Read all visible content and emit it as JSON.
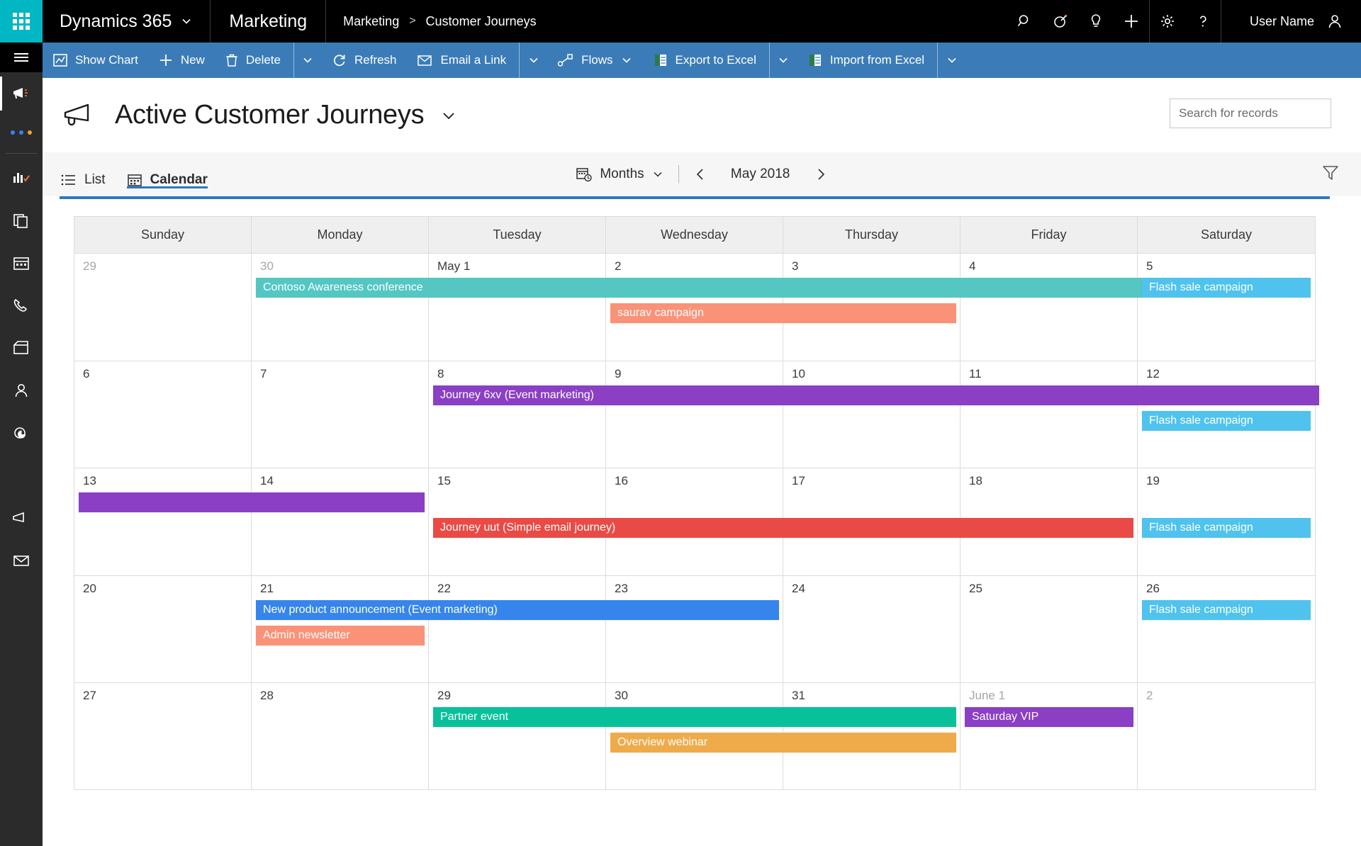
{
  "topbar": {
    "waffle_label": "app-launcher",
    "brand": "Dynamics 365",
    "app_name": "Marketing",
    "breadcrumb": {
      "root": "Marketing",
      "separator": ">",
      "current": "Customer Journeys"
    },
    "icons": [
      "search-icon",
      "target-icon",
      "lightbulb-icon",
      "plus-icon",
      "gear-icon",
      "help-icon"
    ],
    "user_name": "User Name"
  },
  "rail": {
    "items": [
      "hamburger-menu",
      "megaphone-marketing",
      "overflow-dots",
      "dashboards",
      "documents",
      "calendar",
      "phone",
      "archive",
      "contacts",
      "analytics",
      "campaigns",
      "email"
    ]
  },
  "commandbar": {
    "items": [
      {
        "label": "Show Chart",
        "icon": "chart-icon",
        "chevron": false
      },
      {
        "label": "New",
        "icon": "plus-icon",
        "chevron": false
      },
      {
        "label": "Delete",
        "icon": "trash-icon",
        "chevron": true
      },
      {
        "label": "Refresh",
        "icon": "refresh-icon",
        "chevron": false
      },
      {
        "label": "Email a Link",
        "icon": "email-link-icon",
        "chevron": true
      },
      {
        "label": "Flows",
        "icon": "flows-icon",
        "chevron": true
      },
      {
        "label": "Export to Excel",
        "icon": "excel-icon",
        "chevron": true
      },
      {
        "label": "Import from Excel",
        "icon": "excel-import-icon",
        "chevron": true
      }
    ]
  },
  "page": {
    "title": "Active Customer Journeys",
    "title_icon": "megaphone-icon",
    "title_chevron": "chevron-down-icon"
  },
  "search": {
    "placeholder": "Search for records",
    "value": "",
    "icon": "search-icon"
  },
  "toolbar": {
    "tabs": [
      {
        "label": "List",
        "icon": "list-icon",
        "active": false
      },
      {
        "label": "Calendar",
        "icon": "calendar-icon",
        "active": true
      }
    ],
    "scale_label": "Months",
    "scale_icon": "calendar-clock-icon",
    "prev_icon": "chevron-left-icon",
    "next_icon": "chevron-right-icon",
    "period_label": "May 2018",
    "filter_icon": "filter-funnel-icon"
  },
  "calendar": {
    "day_headers": [
      "Sunday",
      "Monday",
      "Tuesday",
      "Wednesday",
      "Thursday",
      "Friday",
      "Saturday"
    ],
    "weeks": [
      {
        "days": [
          {
            "label": "29",
            "muted": true
          },
          {
            "label": "30",
            "muted": true
          },
          {
            "label": "May 1",
            "muted": false
          },
          {
            "label": "2",
            "muted": false
          },
          {
            "label": "3",
            "muted": false
          },
          {
            "label": "4",
            "muted": false
          },
          {
            "label": "5",
            "muted": false
          }
        ],
        "events": [
          {
            "title": "Contoso Awareness conference",
            "start": 1,
            "span": 5,
            "row": 0,
            "color": "#54C7C3",
            "continues_right": true
          },
          {
            "title": "Flash sale campaign",
            "start": 6,
            "span": 1,
            "row": 0,
            "color": "#4FC3ED"
          },
          {
            "title": "saurav campaign",
            "start": 3,
            "span": 2,
            "row": 1,
            "color": "#FA9278"
          }
        ]
      },
      {
        "days": [
          {
            "label": "6",
            "muted": false
          },
          {
            "label": "7",
            "muted": false
          },
          {
            "label": "8",
            "muted": false
          },
          {
            "label": "9",
            "muted": false
          },
          {
            "label": "10",
            "muted": false
          },
          {
            "label": "11",
            "muted": false
          },
          {
            "label": "12",
            "muted": false
          }
        ],
        "events": [
          {
            "title": "Journey 6xv (Event marketing)",
            "start": 2,
            "span": 5,
            "row": 0,
            "color": "#8B3FC4",
            "continues_right": true
          },
          {
            "title": "Flash sale campaign",
            "start": 6,
            "span": 1,
            "row": 1,
            "color": "#4FC3ED"
          }
        ]
      },
      {
        "days": [
          {
            "label": "13",
            "muted": false
          },
          {
            "label": "14",
            "muted": false
          },
          {
            "label": "15",
            "muted": false
          },
          {
            "label": "16",
            "muted": false
          },
          {
            "label": "17",
            "muted": false
          },
          {
            "label": "18",
            "muted": false
          },
          {
            "label": "19",
            "muted": false
          }
        ],
        "events": [
          {
            "title": "",
            "start": 0,
            "span": 2,
            "row": 0,
            "color": "#8B3FC4"
          },
          {
            "title": "Journey uut (Simple email journey)",
            "start": 2,
            "span": 4,
            "row": 1,
            "color": "#EA4A45"
          },
          {
            "title": "Flash sale campaign",
            "start": 6,
            "span": 1,
            "row": 1,
            "color": "#4FC3ED"
          }
        ]
      },
      {
        "days": [
          {
            "label": "20",
            "muted": false
          },
          {
            "label": "21",
            "muted": false
          },
          {
            "label": "22",
            "muted": false
          },
          {
            "label": "23",
            "muted": false
          },
          {
            "label": "24",
            "muted": false
          },
          {
            "label": "25",
            "muted": false
          },
          {
            "label": "26",
            "muted": false
          }
        ],
        "events": [
          {
            "title": "New product announcement (Event marketing)",
            "start": 1,
            "span": 3,
            "row": 0,
            "color": "#3585ED"
          },
          {
            "title": "Flash sale campaign",
            "start": 6,
            "span": 1,
            "row": 0,
            "color": "#4FC3ED"
          },
          {
            "title": "Admin newsletter",
            "start": 1,
            "span": 1,
            "row": 1,
            "color": "#FA9278"
          }
        ]
      },
      {
        "days": [
          {
            "label": "27",
            "muted": false
          },
          {
            "label": "28",
            "muted": false
          },
          {
            "label": "29",
            "muted": false
          },
          {
            "label": "30",
            "muted": false
          },
          {
            "label": "31",
            "muted": false
          },
          {
            "label": "June 1",
            "muted": true
          },
          {
            "label": "2",
            "muted": true
          }
        ],
        "events": [
          {
            "title": "Partner event",
            "start": 2,
            "span": 3,
            "row": 0,
            "color": "#08C19B"
          },
          {
            "title": "Saturday VIP",
            "start": 5,
            "span": 1,
            "row": 0,
            "color": "#8B3FC4"
          },
          {
            "title": "Overview webinar",
            "start": 3,
            "span": 2,
            "row": 1,
            "color": "#EFAB4A"
          }
        ]
      }
    ]
  },
  "colors": {
    "accent_blue": "#2a7ac0",
    "command_bar": "#3b7cb8",
    "waffle_teal": "#00B7C3",
    "rail_bg": "#2b2b2b"
  }
}
